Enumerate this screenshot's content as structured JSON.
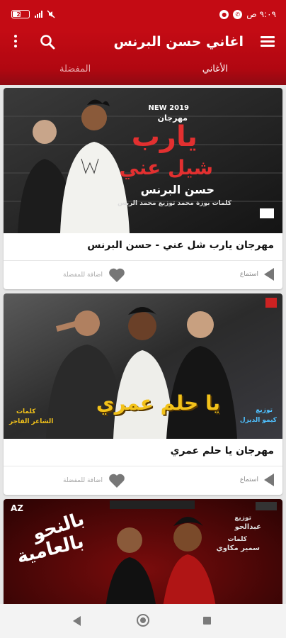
{
  "status_bar": {
    "time": "٩:٠٩ ص",
    "battery": "26",
    "icons": [
      "battery-icon",
      "signal-icon",
      "wifi-icon",
      "mute-icon",
      "whatsapp-icon",
      "circle-notification-icon"
    ]
  },
  "app_bar": {
    "title": "اغاني حسن البرنس",
    "menu_icon": "hamburger-menu-icon",
    "search_icon": "search-icon",
    "more_icon": "more-vert-icon"
  },
  "tabs": [
    {
      "label": "الأغاني",
      "selected": true
    },
    {
      "label": "المفضلة",
      "selected": false
    }
  ],
  "songs": [
    {
      "title": "مهرجان يارب شل عني - حسن البرنس",
      "listen_label": "استماع",
      "favorite_label": "اضافة للمفضلة",
      "art": {
        "badge": "NEW 2019",
        "festival": "مهرجان",
        "line1": "يارب",
        "line2": "شيل عني",
        "artist": "حسن البرنس",
        "credits": "كلمات بوزة محمد   توزيع محمد الريس"
      }
    },
    {
      "title": "مهرجان يا حلم عمري",
      "listen_label": "استماع",
      "favorite_label": "اضافة للمفضلة",
      "art": {
        "big": "يا حلم عمري",
        "left_top": "كلمات",
        "left_bottom": "الشاعر الفاجر",
        "right_top": "توزيع",
        "right_bottom": "كيمو الديزل"
      }
    },
    {
      "title": "",
      "art": {
        "corner": "AZ",
        "line1": "بالنحو",
        "line2": "بالعامية",
        "right_top": "توزيع",
        "right_name1": "عبدالحو",
        "right_mid": "كلمات",
        "right_name2": "سمير مكاوي"
      }
    }
  ],
  "colors": {
    "primary": "#c40b14",
    "primary_dark": "#8f0a12",
    "tab_inactive": "#e9a9ac"
  },
  "nav_bar": {
    "icons": [
      "back-icon",
      "home-icon",
      "recents-icon"
    ]
  }
}
